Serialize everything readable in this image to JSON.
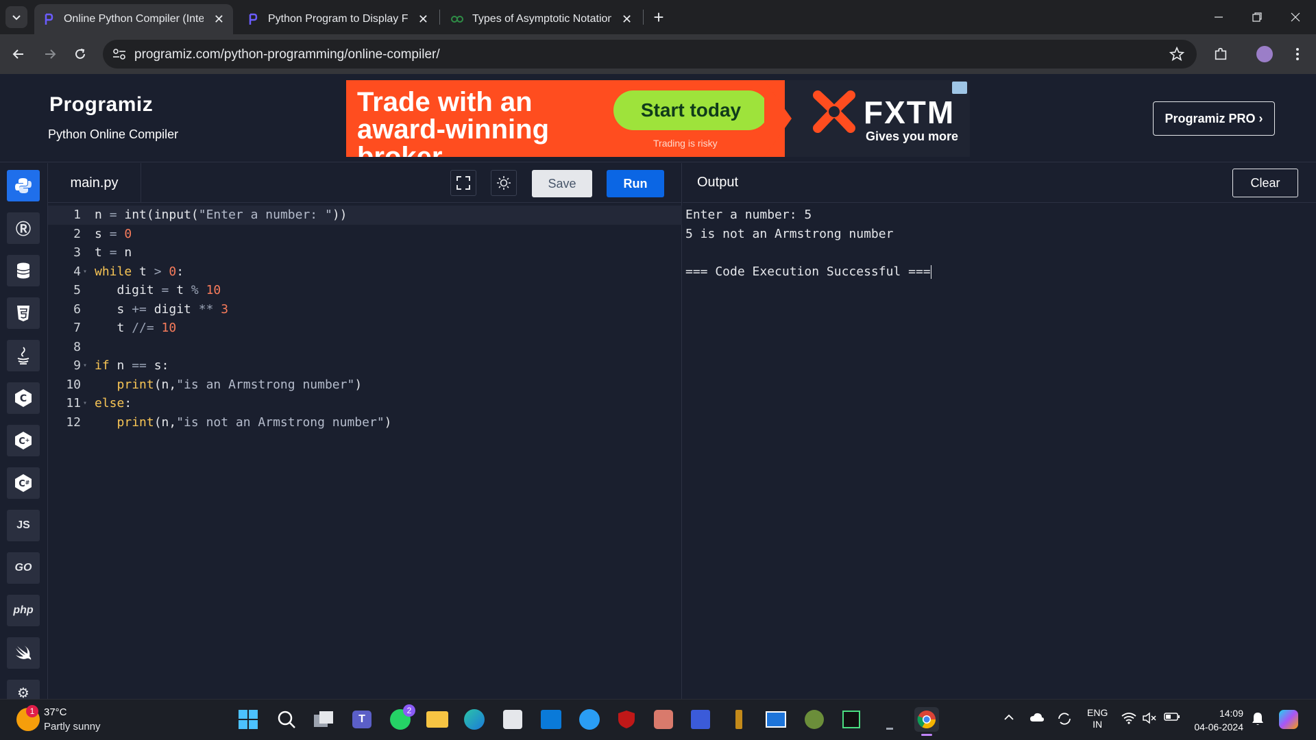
{
  "browser": {
    "tabs": [
      {
        "title": "Online Python Compiler (Interpreter)",
        "active": true
      },
      {
        "title": "Python Program to Display Fibonacci Sequence",
        "active": false
      },
      {
        "title": "Types of Asymptotic Notations in Complexity Analysis",
        "active": false
      }
    ],
    "url": "programiz.com/python-programming/online-compiler/"
  },
  "header": {
    "logo": "Programiz",
    "subtitle": "Python Online Compiler",
    "pro_button": "Programiz PRO ›"
  },
  "ad": {
    "headline": "Trade with an award-winning broker.",
    "cta": "Start today",
    "risk": "Trading is risky",
    "brand": "FXTM",
    "tagline": "Gives you more"
  },
  "sidebar": {
    "languages": [
      "Python",
      "R",
      "SQL",
      "HTML",
      "Java",
      "C",
      "C++",
      "C#",
      "JS",
      "GO",
      "php",
      "Swift",
      "Rust"
    ]
  },
  "editor": {
    "filename": "main.py",
    "save_label": "Save",
    "run_label": "Run",
    "line_numbers": [
      "1",
      "2",
      "3",
      "4",
      "5",
      "6",
      "7",
      "8",
      "9",
      "10",
      "11",
      "12"
    ]
  },
  "output": {
    "title": "Output",
    "clear_label": "Clear",
    "lines": [
      "Enter a number: 5",
      "5 is not an Armstrong number",
      "",
      "=== Code Execution Successful ==="
    ]
  },
  "taskbar": {
    "temperature": "37°C",
    "condition": "Partly sunny",
    "weather_badge": "1",
    "whatsapp_badge": "2",
    "lang_line1": "ENG",
    "lang_line2": "IN",
    "time": "14:09",
    "date": "04-06-2024"
  },
  "colors": {
    "accent": "#0b66e4",
    "background": "#1a1f2e",
    "ad_orange": "#ff4d1f",
    "cta_green": "#9ee33b"
  }
}
